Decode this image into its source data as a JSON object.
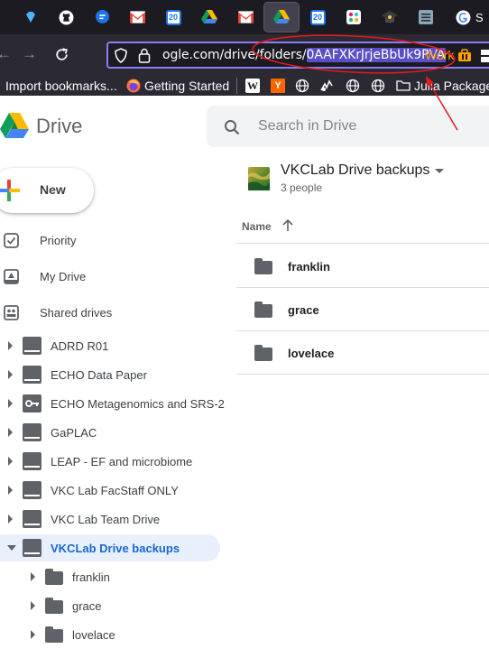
{
  "browser": {
    "url_prefix": "ogle.com/drive/folders/",
    "url_selected": "0AAFXKrJrjeBbUk9PVA",
    "container": "Work",
    "tab_calendar_day": "20",
    "bookmarks": [
      {
        "label": "Import bookmarks..."
      },
      {
        "label": "Getting Started"
      },
      {
        "label": "Julia Packages"
      }
    ],
    "bookmark_icons": [
      "W",
      "Y"
    ]
  },
  "drive": {
    "title": "Drive",
    "search_placeholder": "Search in Drive",
    "new_label": "New",
    "nav": [
      "Priority",
      "My Drive",
      "Shared drives"
    ],
    "shared_drives": [
      "ADRD R01",
      "ECHO Data Paper",
      "ECHO Metagenomics and SRS-2",
      "GaPLAC",
      "LEAP - EF and microbiome",
      "VKC Lab FacStaff ONLY",
      "VKC Lab Team Drive",
      "VKCLab Drive backups"
    ],
    "subfolders": [
      "franklin",
      "grace",
      "lovelace"
    ],
    "folder": {
      "name": "VKCLab Drive backups",
      "subtitle": "3 people",
      "column_name": "Name",
      "items": [
        "franklin",
        "grace",
        "lovelace"
      ]
    }
  }
}
